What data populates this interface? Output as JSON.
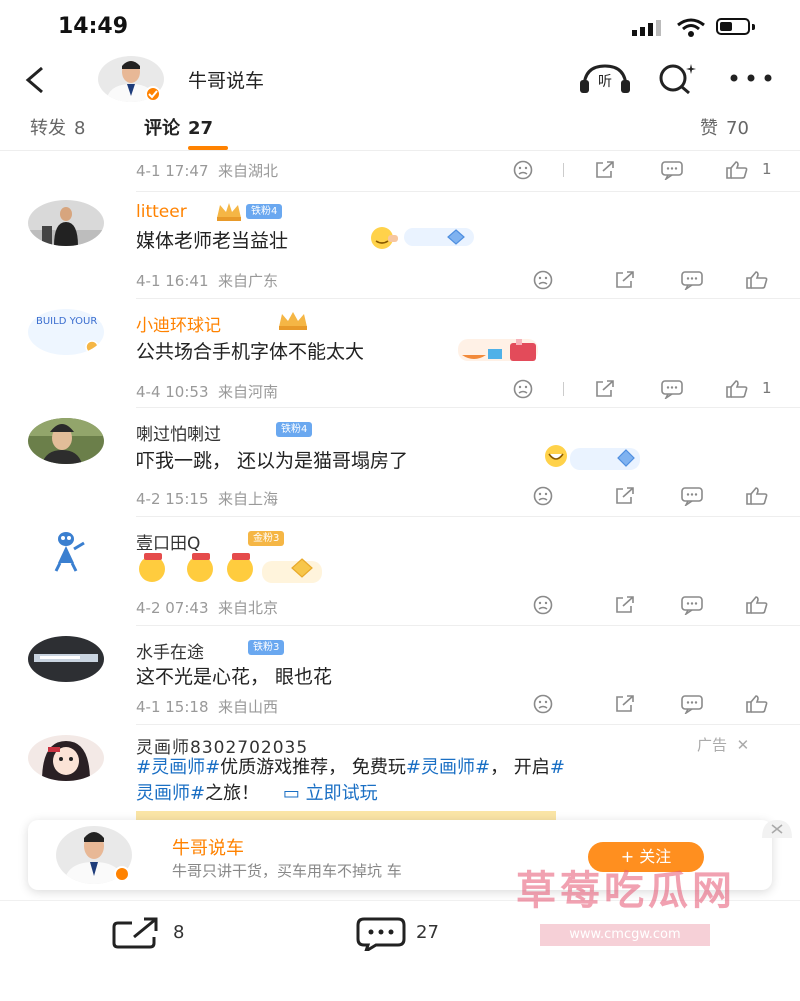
{
  "status_bar": {
    "time": "14:49",
    "battery_level": 0.45
  },
  "nav": {
    "title": "牛哥说车"
  },
  "tabs": {
    "repost": {
      "label": "转发",
      "count": "8"
    },
    "comment": {
      "label": "评论",
      "count": "27"
    },
    "like": {
      "label": "赞",
      "count": "70"
    }
  },
  "top_meta": {
    "time": "4-1 17:47",
    "location": "来自湖北",
    "like_count": "1"
  },
  "comments": [
    {
      "name": "litteer",
      "badge": "铁粉4",
      "text": "媒体老师老当益壮",
      "time": "4-1 16:41",
      "location": "来自广东",
      "like_count": ""
    },
    {
      "name": "小迪环球记",
      "badge": "",
      "text": "公共场合手机字体不能太大",
      "time": "4-4 10:53",
      "location": "来自河南",
      "like_count": "1",
      "avatar_text": "BUILD YOUR DREAMS"
    },
    {
      "name": "喇过怕喇过",
      "badge": "铁粉4",
      "text": "吓我一跳， 还以为是猫哥塌房了",
      "time": "4-2 15:15",
      "location": "来自上海",
      "like_count": ""
    },
    {
      "name": "壹口田Q",
      "badge": "金粉3",
      "text": "",
      "time": "4-2 07:43",
      "location": "来自北京",
      "like_count": ""
    },
    {
      "name": "水手在途",
      "badge": "铁粉3",
      "text": "这不光是心花， 眼也花",
      "time": "4-1 15:18",
      "location": "来自山西",
      "like_count": ""
    }
  ],
  "ad": {
    "name": "灵画师8302702035",
    "label": "广告",
    "line1_tag": "#灵画师#",
    "line1_text": "优质游戏推荐， 免费玩",
    "line1_tag2": "#灵画师#",
    "line1_text2": "， 开启",
    "line1_tag3": "#",
    "line2_tag": "灵画师#",
    "line2_text": "之旅！",
    "link_text": "立即试玩"
  },
  "follow_card": {
    "name": "牛哥说车",
    "desc": "牛哥只讲干货，买车用车不掉坑 车",
    "button": "+ 关注"
  },
  "bottom_bar": {
    "repost_count": "8",
    "comment_count": "27"
  },
  "watermark": {
    "text": "草莓吃瓜网",
    "url": "www.cmcgw.com"
  },
  "colors": {
    "accent": "#ff8200",
    "badge_blue": "#6aa8f0",
    "badge_gold": "#f5b645",
    "link": "#1a6fc4"
  }
}
